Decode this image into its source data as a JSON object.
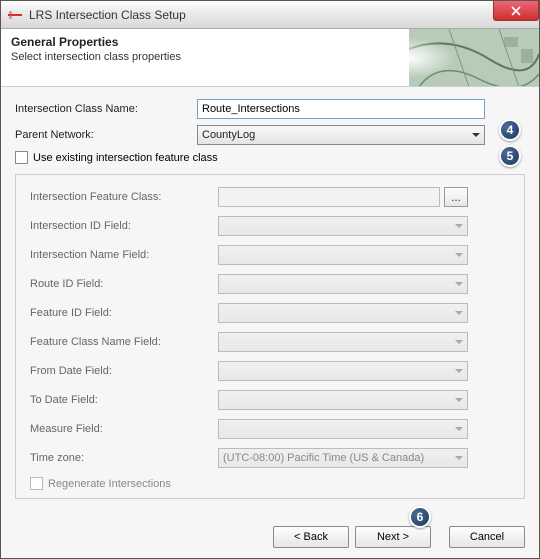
{
  "window": {
    "title": "LRS Intersection Class Setup"
  },
  "header": {
    "title": "General Properties",
    "subtitle": "Select intersection class properties"
  },
  "fields": {
    "class_name": {
      "label": "Intersection Class Name:",
      "value": "Route_Intersections"
    },
    "parent_network": {
      "label": "Parent Network:",
      "value": "CountyLog"
    },
    "use_existing": {
      "label": "Use existing intersection feature class",
      "checked": false
    }
  },
  "group": {
    "feature_class": {
      "label": "Intersection Feature Class:",
      "value": ""
    },
    "id_field": {
      "label": "Intersection ID Field:",
      "value": ""
    },
    "name_field": {
      "label": "Intersection Name Field:",
      "value": ""
    },
    "route_id": {
      "label": "Route ID Field:",
      "value": ""
    },
    "feature_id": {
      "label": "Feature ID Field:",
      "value": ""
    },
    "fc_name": {
      "label": "Feature Class Name Field:",
      "value": ""
    },
    "from_date": {
      "label": "From Date Field:",
      "value": ""
    },
    "to_date": {
      "label": "To Date Field:",
      "value": ""
    },
    "measure": {
      "label": "Measure Field:",
      "value": ""
    },
    "timezone": {
      "label": "Time zone:",
      "value": "(UTC-08:00) Pacific Time (US & Canada)"
    },
    "regenerate": {
      "label": "Regenerate Intersections",
      "checked": false
    }
  },
  "badges": {
    "b4": "4",
    "b5": "5",
    "b6": "6"
  },
  "buttons": {
    "back": "< Back",
    "next": "Next >",
    "cancel": "Cancel"
  }
}
